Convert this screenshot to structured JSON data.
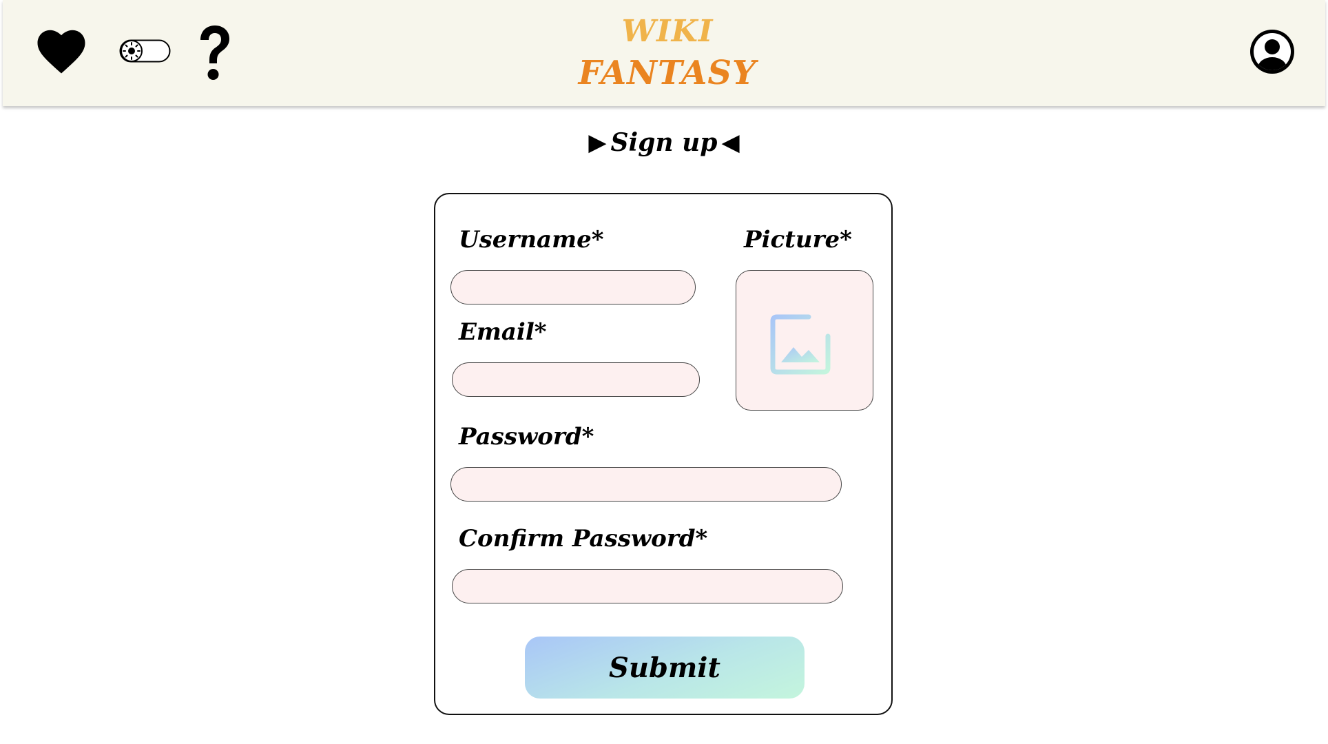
{
  "header": {
    "logo_line1": "WIKI",
    "logo_line2": "FANTASY",
    "icons": [
      "heart-icon",
      "theme-toggle-icon",
      "help-icon",
      "account-icon"
    ],
    "colors": {
      "background": "#f7f6ec",
      "logo_top": "#f0b34a",
      "logo_bottom": "#ea8420"
    }
  },
  "page": {
    "title": "Sign up"
  },
  "form": {
    "username_label": "Username*",
    "picture_label": "Picture*",
    "email_label": "Email*",
    "password_label": "Password*",
    "confirm_password_label": "Confirm Password*",
    "username_value": "",
    "email_value": "",
    "password_value": "",
    "confirm_password_value": "",
    "picture_icon": "add-image-icon",
    "submit_label": "Submit",
    "colors": {
      "field_bg": "#fdf0f0",
      "submit_gradient_start": "#a9c6f7",
      "submit_gradient_end": "#c4f5dd"
    }
  }
}
